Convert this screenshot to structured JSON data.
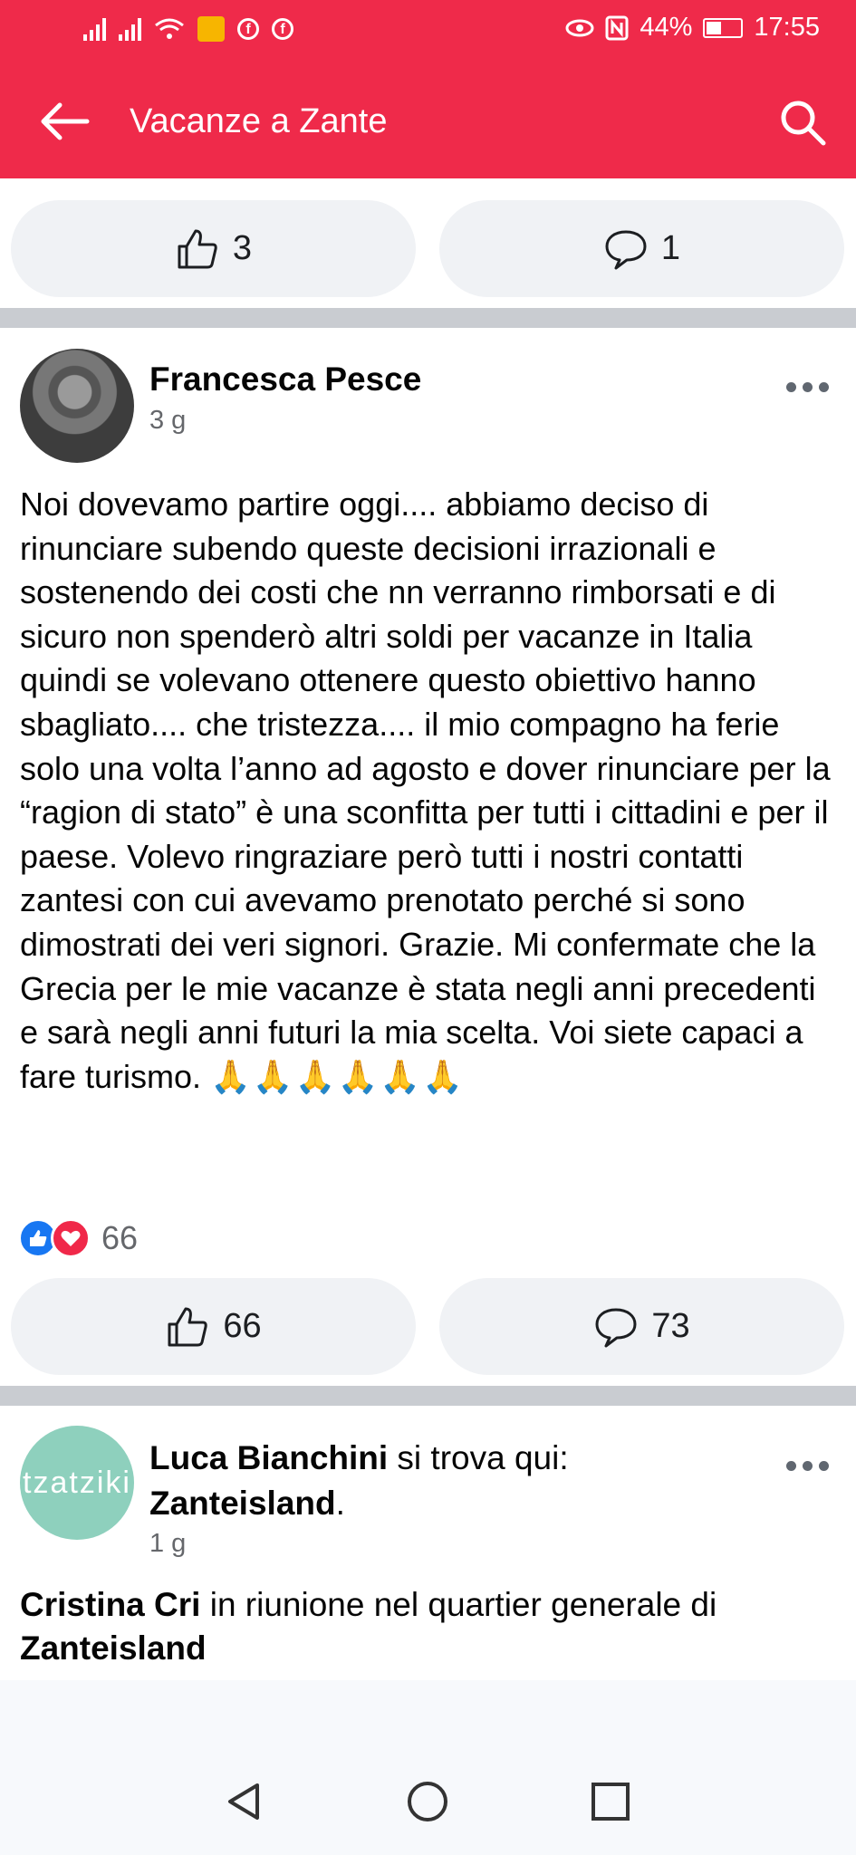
{
  "statusbar": {
    "battery": "44%",
    "time": "17:55"
  },
  "appbar": {
    "title": "Vacanze a Zante"
  },
  "post_prev": {
    "like_count": "3",
    "comment_count": "1"
  },
  "post1": {
    "author": "Francesca Pesce",
    "time": "3 g",
    "text": "Noi dovevamo partire oggi.... abbiamo deciso di rinunciare subendo queste decisioni irrazionali e sostenendo dei costi che nn verranno rimborsati e di sicuro non spenderò altri soldi per vacanze in Italia quindi se volevano ottenere questo obiettivo hanno sbagliato.... che tristezza.... il mio compagno ha ferie solo una volta l’anno ad agosto e dover rinunciare per la “ragion di stato” è una sconfitta per tutti i cittadini e per il paese. Volevo ringraziare però tutti i nostri contatti zantesi con cui avevamo prenotato perché si sono dimostrati dei veri signori. Grazie. Mi confermate che la Grecia per le mie vacanze è stata negli anni precedenti e sarà negli anni futuri la mia scelta. Voi siete capaci a fare turismo.",
    "emoji": "🙏🙏🙏🙏🙏🙏",
    "reaction_count": "66",
    "like_count": "66",
    "comment_count": "73"
  },
  "post2": {
    "author": "Luca Bianchini",
    "checkin_text": " si trova qui: ",
    "place": "Zanteisland",
    "place_suffix": ".",
    "time": "1 g",
    "avatar_text": "tzatziki",
    "line_author": "Cristina Cri",
    "line_text": " in riunione nel quartier generale di ",
    "line_place": "Zanteisland"
  },
  "colors": {
    "brand": "#ef2a4a",
    "like_blue": "#1877f2",
    "love_red": "#f02849",
    "button_bg": "#f0f2f5"
  }
}
